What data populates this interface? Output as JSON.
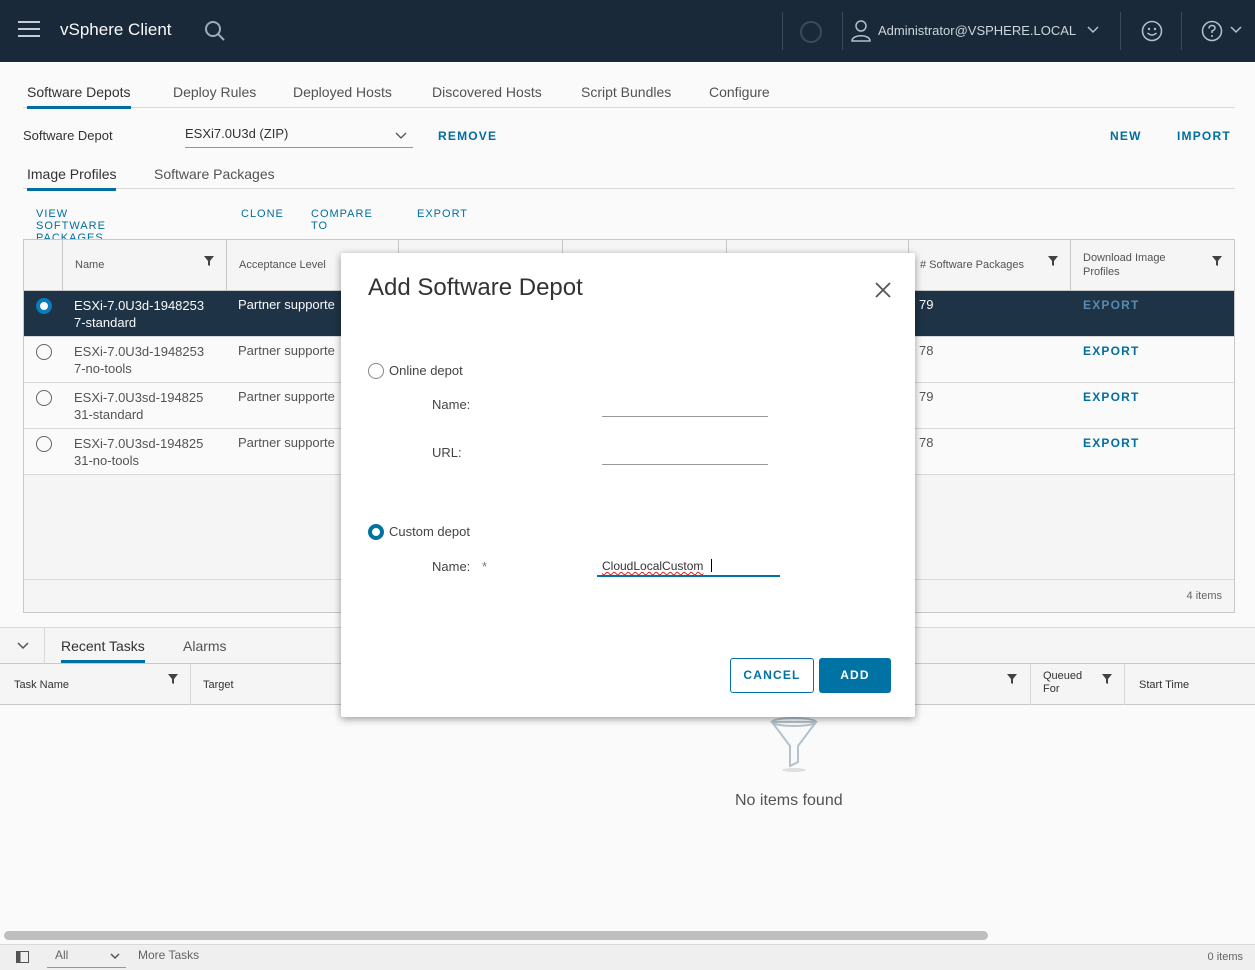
{
  "header": {
    "app_title": "vSphere Client",
    "user": "Administrator@VSPHERE.LOCAL"
  },
  "main_tabs": [
    "Software Depots",
    "Deploy Rules",
    "Deployed Hosts",
    "Discovered Hosts",
    "Script Bundles",
    "Configure"
  ],
  "depot": {
    "label": "Software Depot",
    "selected": "ESXi7.0U3d (ZIP)",
    "remove": "REMOVE",
    "new": "NEW",
    "import": "IMPORT"
  },
  "sub_tabs": [
    "Image Profiles",
    "Software Packages"
  ],
  "toolbar": [
    "VIEW SOFTWARE PACKAGES",
    "CLONE",
    "COMPARE TO",
    "EXPORT"
  ],
  "grid": {
    "columns": {
      "name": "Name",
      "acceptance": "Acceptance Level",
      "packages": "# Software Packages",
      "download_line1": "Download Image",
      "download_line2": "Profiles"
    },
    "rows": [
      {
        "name1": "ESXi-7.0U3d-1948253",
        "name2": "7-standard",
        "acceptance": "Partner supporte",
        "packages": "79",
        "action": "EXPORT"
      },
      {
        "name1": "ESXi-7.0U3d-1948253",
        "name2": "7-no-tools",
        "acceptance": "Partner supporte",
        "packages": "78",
        "action": "EXPORT"
      },
      {
        "name1": "ESXi-7.0U3sd-194825",
        "name2": "31-standard",
        "acceptance": "Partner supporte",
        "packages": "79",
        "action": "EXPORT"
      },
      {
        "name1": "ESXi-7.0U3sd-194825",
        "name2": "31-no-tools",
        "acceptance": "Partner supporte",
        "packages": "78",
        "action": "EXPORT"
      }
    ],
    "footer": "4 items"
  },
  "bottom": {
    "tabs": [
      "Recent Tasks",
      "Alarms"
    ],
    "columns": {
      "task_name": "Task Name",
      "target": "Target",
      "queued1": "Queued",
      "queued2": "For",
      "start_time": "Start Time"
    },
    "empty_text": "No items found",
    "filter_value": "All",
    "more_tasks": "More Tasks",
    "count": "0 items"
  },
  "modal": {
    "title": "Add Software Depot",
    "online_label": "Online depot",
    "name_label": "Name:",
    "url_label": "URL:",
    "custom_label": "Custom depot",
    "custom_name_label": "Name:",
    "required_mark": "*",
    "custom_name_value": "CloudLocalCustom",
    "cancel": "CANCEL",
    "add": "ADD"
  }
}
